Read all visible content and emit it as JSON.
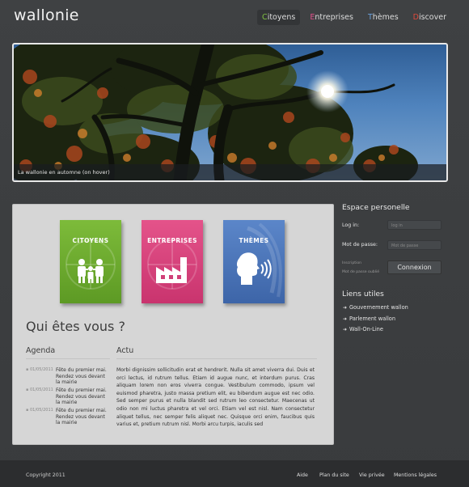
{
  "header": {
    "logo": "wallonie",
    "nav": [
      {
        "initial": "C",
        "rest": "itoyens",
        "color": "#7fc241"
      },
      {
        "initial": "E",
        "rest": "ntreprises",
        "color": "#e0508a"
      },
      {
        "initial": "T",
        "rest": "hèmes",
        "color": "#6aa0dc"
      },
      {
        "initial": "D",
        "rest": "iscover",
        "color": "#e04a3c"
      }
    ]
  },
  "hero": {
    "caption": "La wallonie en automne (on hover)"
  },
  "tiles": [
    {
      "label": "CITOYENS",
      "icon": "family-icon"
    },
    {
      "label": "ENTREPRISES",
      "icon": "factory-icon"
    },
    {
      "label": "THÈMES",
      "icon": "speaking-head-icon"
    }
  ],
  "main": {
    "heading": "Qui êtes vous ?",
    "agenda_title": "Agenda",
    "actu_title": "Actu",
    "agenda_items": [
      {
        "date": "01/05/2011",
        "text": "Fête du premier mai. Rendez vous devant la mairie"
      },
      {
        "date": "01/05/2011",
        "text": "Fête du premier mai. Rendez vous devant la mairie"
      },
      {
        "date": "01/05/2011",
        "text": "Fête du premier mai. Rendez vous devant la mairie"
      }
    ],
    "actu_text": "Morbi dignissim sollicitudin erat et hendrerit. Nulla sit amet viverra dui. Duis et orci lectus, id rutrum tellus. Etiam id augue nunc, et interdum purus. Cras aliquam lorem non eros viverra congue. Vestibulum commodo, ipsum vel euismod pharetra, justo massa pretium elit, eu bibendum augue est nec odio. Sed semper purus et nulla blandit sed rutrum leo consectetur. Maecenas ut odio non mi luctus pharetra et vel orci. Etiam vel est nisl. Nam consectetur aliquet tellus, nec semper felis aliquet nec. Quisque orci enim, faucibus quis varius et, pretium rutrum nisl. Morbi arcu turpis, iaculis sed"
  },
  "sidebar": {
    "espace_title": "Espace personelle",
    "login_label": "Log in:",
    "login_placeholder": "log in",
    "password_label": "Mot de passe:",
    "password_placeholder": "Mot de passe",
    "inscription": "Inscription",
    "forgot": "Mot de passe oublié",
    "connect_button": "Connexion",
    "liens_title": "Liens utiles",
    "links": [
      "Gouvernement wallon",
      "Parlement wallon",
      "Wall-On-Line"
    ]
  },
  "footer": {
    "copyright": "Copyright 2011",
    "links": [
      "Aide",
      "Plan du site",
      "Vie privée",
      "Mentions légales"
    ]
  }
}
